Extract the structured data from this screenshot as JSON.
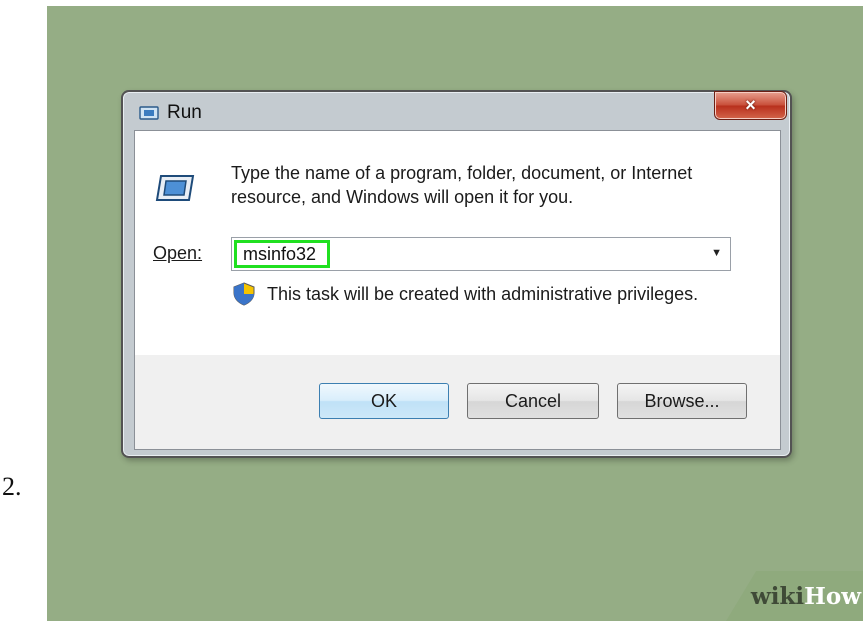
{
  "step": {
    "number": "2."
  },
  "window": {
    "title": "Run",
    "close_glyph": "×",
    "title_icon": "run-icon",
    "description": "Type the name of a program, folder, document, or Internet resource, and Windows will open it for you.",
    "open_label": "Open:",
    "open_value": "msinfo32",
    "dropdown_glyph": "▼",
    "admin_note": "This task will be created with administrative privileges.",
    "buttons": {
      "ok": "OK",
      "cancel": "Cancel",
      "browse": "Browse..."
    }
  },
  "watermark": {
    "part1": "wiki",
    "part2": "How"
  },
  "colors": {
    "background": "#95ad85",
    "highlight": "#20e020",
    "close_button": "#c9503b"
  }
}
